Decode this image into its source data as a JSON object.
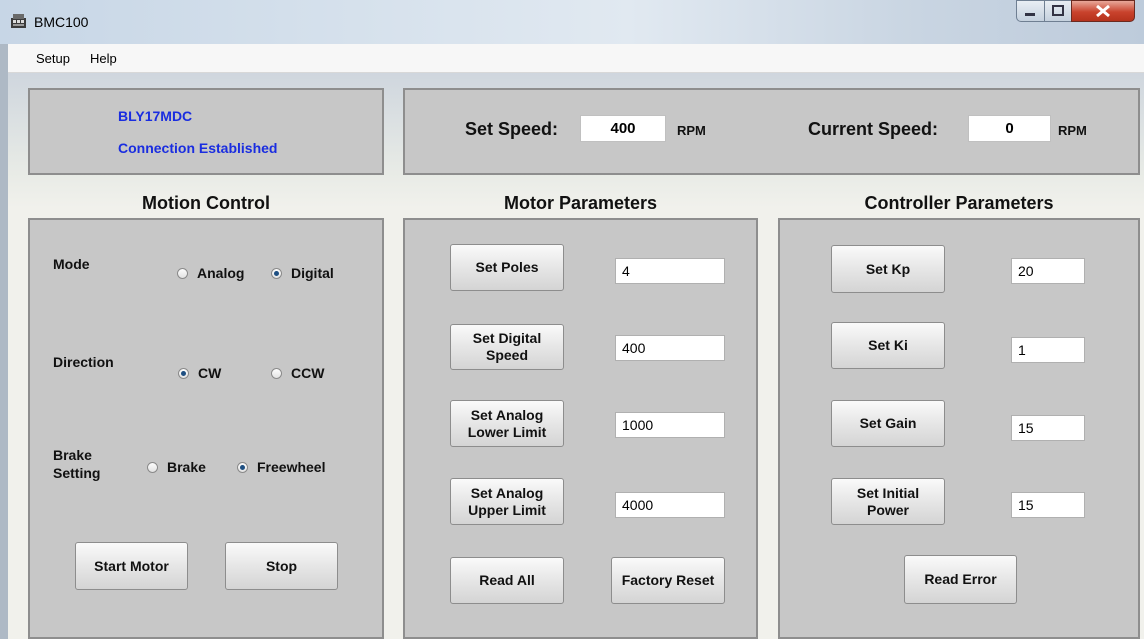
{
  "window": {
    "title": "BMC100"
  },
  "menu": {
    "items": [
      "Setup",
      "Help"
    ]
  },
  "status": {
    "device": "BLY17MDC",
    "connection": "Connection Established"
  },
  "speed": {
    "set_label": "Set Speed:",
    "set_value": "400",
    "set_unit": "RPM",
    "current_label": "Current Speed:",
    "current_value": "0",
    "current_unit": "RPM"
  },
  "motion": {
    "heading": "Motion Control",
    "mode_label": "Mode",
    "mode_options": [
      "Analog",
      "Digital"
    ],
    "mode_selected": "Digital",
    "direction_label": "Direction",
    "direction_options": [
      "CW",
      "CCW"
    ],
    "direction_selected": "CW",
    "brake_label_1": "Brake",
    "brake_label_2": "Setting",
    "brake_options": [
      "Brake",
      "Freewheel"
    ],
    "brake_selected": "Freewheel",
    "start_label": "Start Motor",
    "stop_label": "Stop"
  },
  "motor": {
    "heading": "Motor Parameters",
    "poles_label": "Set Poles",
    "poles_value": "4",
    "digital_label": "Set Digital Speed",
    "digital_value": "400",
    "lower_label": "Set Analog Lower Limit",
    "lower_value": "1000",
    "upper_label": "Set Analog Upper Limit",
    "upper_value": "4000",
    "read_all_label": "Read All",
    "factory_label": "Factory Reset"
  },
  "controller": {
    "heading": "Controller Parameters",
    "kp_label": "Set Kp",
    "kp_value": "20",
    "ki_label": "Set Ki",
    "ki_value": "1",
    "gain_label": "Set Gain",
    "gain_value": "15",
    "power_label": "Set Initial Power",
    "power_value": "15",
    "read_error_label": "Read Error"
  }
}
